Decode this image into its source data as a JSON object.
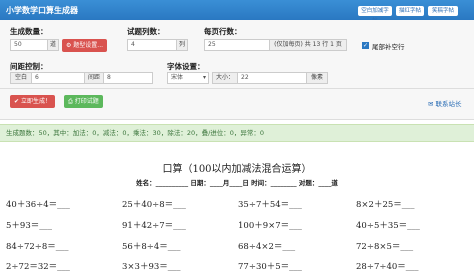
{
  "header": {
    "title": "小学数学口算生成器",
    "buttons": [
      "空白加减字帖",
      "描红字帖",
      "笑稿字帖"
    ]
  },
  "form": {
    "count_label": "生成数量：",
    "count_value": "50",
    "count_unit": "道",
    "type_button": "题型设置...",
    "columns_label": "试题列数：",
    "columns_value": "4",
    "columns_unit": "列",
    "rows_label": "每页行数：",
    "rows_value": "25",
    "rows_hint": "(仅加每页) 共 13 行 1 页",
    "tail_label": "尾部补空行",
    "tail_checked": "✓",
    "spacing_label": "间距控制：",
    "spacing_left": "空白",
    "spacing_left_value": "6",
    "spacing_right": "间距",
    "spacing_right_value": "8",
    "font_label": "字体设置：",
    "font_family": "宋体",
    "font_size_label": "大小：",
    "font_size_value": "22",
    "font_size_unit": "像素",
    "generate_button": "立即生成！",
    "print_button": "打印试题",
    "contact_link": "联系站长"
  },
  "status": "生成题数：50，其中：加法：0，减法：0，乘法：30，除法：20，叠/进位：0，异常：0",
  "sheet": {
    "title": "口算（100以内加减法混合运算）",
    "info": "姓名：__________ 日期：____月____日 时间：________ 对题：____道"
  },
  "problems": [
    [
      "40＋36÷4＝___",
      "25＋40÷8＝___",
      "35÷7＋54＝___",
      "8×2＋25＝___"
    ],
    [
      "5＋93＝___",
      "91＋42÷7＝___",
      "100＋9×7＝___",
      "40÷5＋35＝___"
    ],
    [
      "84÷72÷8＝___",
      "56＋8÷4＝___",
      "68÷4×2＝___",
      "72÷8×5＝___"
    ],
    [
      "2÷72＝32＝___",
      "3×3＋93＝___",
      "77÷30＋5＝___",
      "28÷7÷40＝___"
    ]
  ]
}
